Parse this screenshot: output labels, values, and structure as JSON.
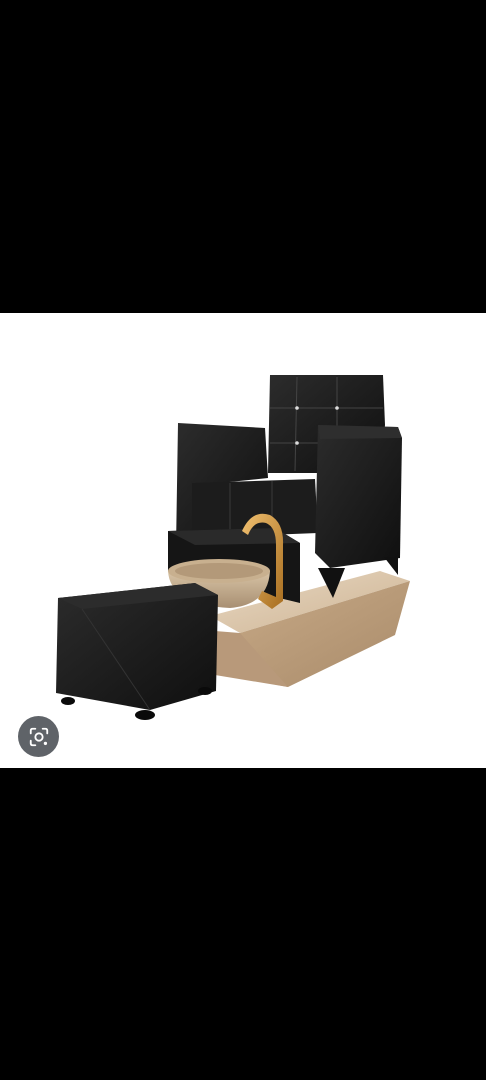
{
  "image": {
    "subject": "pedicure-chair-with-footbath-and-ottoman",
    "background_color": "#ffffff",
    "band_color": "#000000"
  },
  "colors": {
    "leather": "#1a1a1a",
    "leather_highlight": "#3a3a3a",
    "marble": "#d9c3a8",
    "marble_dark": "#b89c7d",
    "gold": "#c8923a"
  },
  "overlay": {
    "lens_button_icon": "lens-search-icon"
  }
}
